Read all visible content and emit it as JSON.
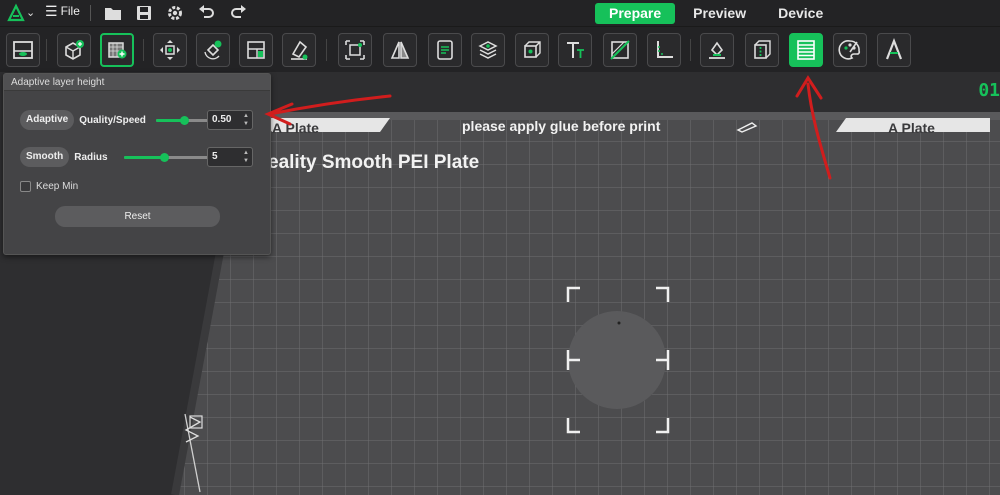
{
  "app": {
    "file_label": "File",
    "tabs": [
      {
        "label": "Prepare",
        "active": true
      },
      {
        "label": "Preview",
        "active": false
      },
      {
        "label": "Device",
        "active": false
      }
    ]
  },
  "toolbar": {
    "icons": [
      "add-plate-icon",
      "add-object-icon",
      "add-part-icon",
      "arrange-icon",
      "auto-orient-icon",
      "split-icon",
      "erase-icon",
      "scale-icon",
      "mirror-icon",
      "text-note-icon",
      "cube-icon",
      "text-icon",
      "cut-icon",
      "measure-icon",
      "support-paint-icon",
      "seam-paint-icon",
      "adaptive-layer-height-icon",
      "color-paint-icon",
      "emboss-text-icon"
    ]
  },
  "viewport": {
    "plate_tab_left": "A Plate",
    "plate_tab_right": "A Plate",
    "plate_note": "please apply glue before print",
    "plate_name": "eality Smooth PEI Plate",
    "counter": "01"
  },
  "panel": {
    "title": "Adaptive layer height",
    "adaptive_button": "Adaptive",
    "quality_label": "Quality/Speed",
    "quality_value": "0.50",
    "quality_fraction": 0.5,
    "smooth_button": "Smooth",
    "radius_label": "Radius",
    "radius_value": "5",
    "radius_fraction": 0.45,
    "keep_min_label": "Keep Min",
    "reset_label": "Reset"
  },
  "colors": {
    "accent": "#16c15a",
    "annotation": "#d11d1d",
    "background": "#232325",
    "bed": "#3a3a3c"
  }
}
